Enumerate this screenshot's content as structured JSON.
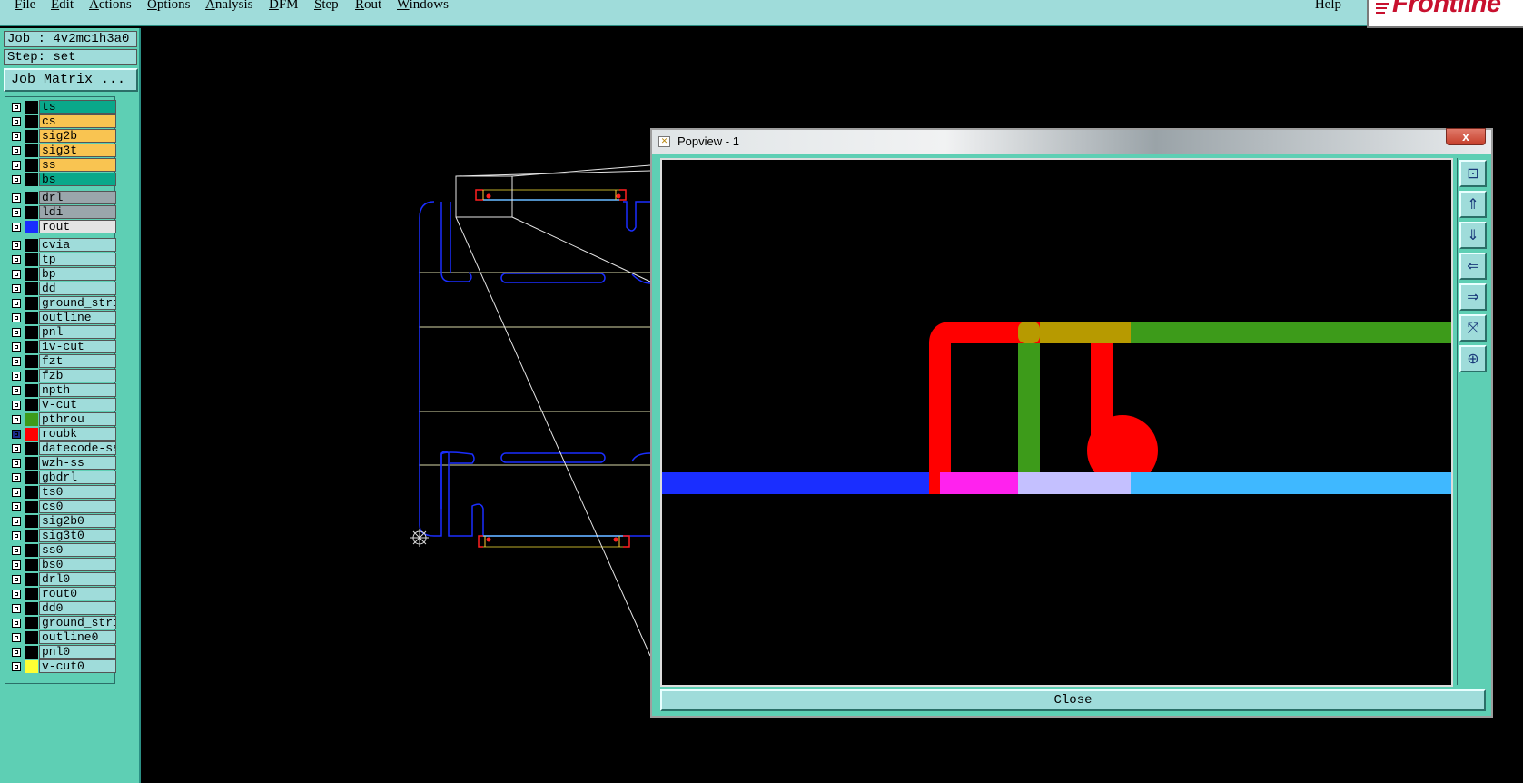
{
  "menu": {
    "items": [
      "File",
      "Edit",
      "Actions",
      "Options",
      "Analysis",
      "DFM",
      "Step",
      "Rout",
      "Windows"
    ],
    "help": "Help"
  },
  "logo": {
    "text": "Frontline"
  },
  "info": {
    "job": "Job : 4v2mc1h3a0",
    "step": "Step: set"
  },
  "job_matrix_label": "Job Matrix ...",
  "layer_groups": [
    [
      {
        "name": "ts",
        "color": "#000000",
        "bg": "#0aa88a"
      },
      {
        "name": "cs",
        "color": "#000000",
        "bg": "#f9c451"
      },
      {
        "name": "sig2b",
        "color": "#000000",
        "bg": "#f9c451"
      },
      {
        "name": "sig3t",
        "color": "#000000",
        "bg": "#f9c451"
      },
      {
        "name": "ss",
        "color": "#000000",
        "bg": "#f9c451"
      },
      {
        "name": "bs",
        "color": "#000000",
        "bg": "#0aa88a"
      }
    ],
    [
      {
        "name": "drl",
        "color": "#000000",
        "bg": "#9aa6ab"
      },
      {
        "name": "ldi",
        "color": "#000000",
        "bg": "#9aa6ab"
      },
      {
        "name": "rout",
        "color": "#1a2eff",
        "bg": "#e4e4e4"
      }
    ],
    [
      {
        "name": "cvia",
        "color": "#000000",
        "bg": "#9fdcda"
      },
      {
        "name": "tp",
        "color": "#000000",
        "bg": "#9fdcda"
      },
      {
        "name": "bp",
        "color": "#000000",
        "bg": "#9fdcda"
      },
      {
        "name": "dd",
        "color": "#000000",
        "bg": "#9fdcda"
      },
      {
        "name": "ground_strip",
        "color": "#000000",
        "bg": "#9fdcda"
      },
      {
        "name": "outline",
        "color": "#000000",
        "bg": "#9fdcda"
      },
      {
        "name": "pnl",
        "color": "#000000",
        "bg": "#9fdcda"
      },
      {
        "name": "1v-cut",
        "color": "#000000",
        "bg": "#9fdcda"
      },
      {
        "name": "fzt",
        "color": "#000000",
        "bg": "#9fdcda"
      },
      {
        "name": "fzb",
        "color": "#000000",
        "bg": "#9fdcda"
      },
      {
        "name": "npth",
        "color": "#000000",
        "bg": "#9fdcda"
      },
      {
        "name": "v-cut",
        "color": "#000000",
        "bg": "#9fdcda"
      },
      {
        "name": "pthrou",
        "color": "#3d9b1a",
        "bg": "#9fdcda"
      },
      {
        "name": "roubk",
        "color": "#ff0000",
        "bg": "#9fdcda",
        "active": true
      },
      {
        "name": "datecode-ss",
        "color": "#000000",
        "bg": "#9fdcda"
      },
      {
        "name": "wzh-ss",
        "color": "#000000",
        "bg": "#9fdcda"
      },
      {
        "name": "gbdrl",
        "color": "#000000",
        "bg": "#9fdcda"
      },
      {
        "name": "ts0",
        "color": "#000000",
        "bg": "#9fdcda"
      },
      {
        "name": "cs0",
        "color": "#000000",
        "bg": "#9fdcda"
      },
      {
        "name": "sig2b0",
        "color": "#000000",
        "bg": "#9fdcda"
      },
      {
        "name": "sig3t0",
        "color": "#000000",
        "bg": "#9fdcda"
      },
      {
        "name": "ss0",
        "color": "#000000",
        "bg": "#9fdcda"
      },
      {
        "name": "bs0",
        "color": "#000000",
        "bg": "#9fdcda"
      },
      {
        "name": "drl0",
        "color": "#000000",
        "bg": "#9fdcda"
      },
      {
        "name": "rout0",
        "color": "#000000",
        "bg": "#9fdcda"
      },
      {
        "name": "dd0",
        "color": "#000000",
        "bg": "#9fdcda"
      },
      {
        "name": "ground_strip",
        "color": "#000000",
        "bg": "#9fdcda"
      },
      {
        "name": "outline0",
        "color": "#000000",
        "bg": "#9fdcda"
      },
      {
        "name": "pnl0",
        "color": "#000000",
        "bg": "#9fdcda"
      },
      {
        "name": "v-cut0",
        "color": "#ffff33",
        "bg": "#9fdcda"
      }
    ]
  ],
  "popview": {
    "title": "Popview - 1",
    "close_x": "x",
    "close_label": "Close",
    "tools": [
      "zoom-window-icon",
      "pan-up-icon",
      "pan-down-icon",
      "pan-left-icon",
      "pan-right-icon",
      "zoom-fit-icon",
      "zoom-home-icon"
    ]
  },
  "colors": {
    "panel": "#5ecfb4",
    "field": "#9fdcda",
    "rout": "#1a2eff",
    "roubk": "#ff0000",
    "pthrou": "#3d9b1a",
    "light_blue": "#3fb8ff"
  }
}
